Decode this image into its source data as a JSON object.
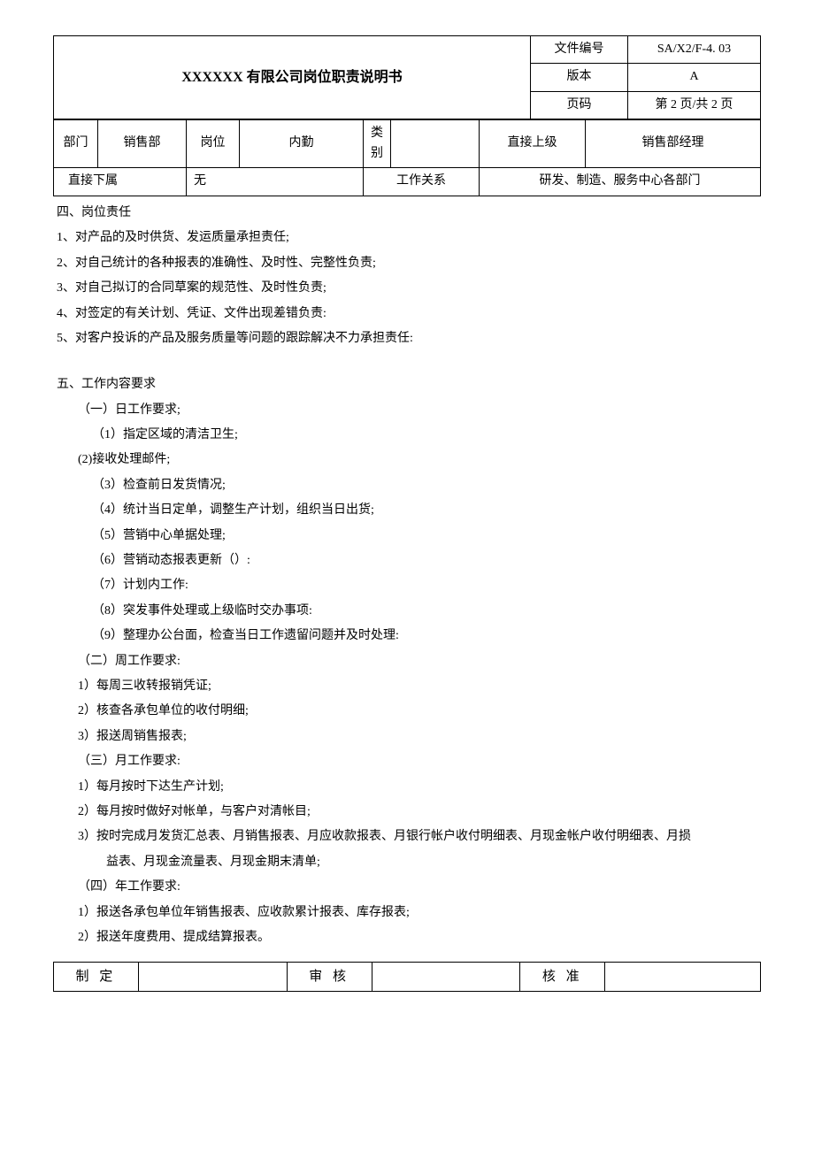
{
  "header": {
    "title": "XXXXXX 有限公司岗位职责说明书",
    "doc_no_label": "文件编号",
    "doc_no_value": "SA/X2/F-4. 03",
    "version_label": "版本",
    "version_value": "A",
    "page_label": "页码",
    "page_value": "第 2 页/共 2 页"
  },
  "info": {
    "dept_label": "部门",
    "dept_value": "销售部",
    "post_label": "岗位",
    "post_value": "内勤",
    "category_label": "类别",
    "category_value": "",
    "super_label": "直接上级",
    "super_value": "销售部经理",
    "sub_label": "直接下属",
    "sub_value": "无",
    "relation_label": "工作关系",
    "relation_value": "研发、制造、服务中心各部门"
  },
  "section4": {
    "title": "四、岗位责任",
    "i1": "1、对产品的及时供货、发运质量承担责任;",
    "i2": "2、对自己统计的各种报表的准确性、及时性、完整性负责;",
    "i3": "3、对自己拟订的合同草案的规范性、及时性负责;",
    "i4": "4、对签定的有关计划、凭证、文件出现差错负责:",
    "i5": "5、对客户投诉的产品及服务质量等问题的跟踪解决不力承担责任:"
  },
  "section5": {
    "title": "五、工作内容要求",
    "daily": {
      "title": "（一）日工作要求;",
      "i1": "（1）指定区域的清洁卫生;",
      "i2": "(2)接收处理邮件;",
      "i3": "（3）检查前日发货情况;",
      "i4": "（4）统计当日定单，调整生产计划，组织当日出货;",
      "i5": "（5）营销中心单据处理;",
      "i6": "（6）营销动态报表更新（）:",
      "i7": "（7）计划内工作:",
      "i8": "（8）突发事件处理或上级临时交办事项:",
      "i9": "（9）整理办公台面，检查当日工作遗留问题并及时处理:"
    },
    "weekly": {
      "title": "（二）周工作要求:",
      "i1": "1）每周三收转报销凭证;",
      "i2": "2）核查各承包单位的收付明细;",
      "i3": "3）报送周销售报表;"
    },
    "monthly": {
      "title": "（三）月工作要求:",
      "i1": "1）每月按时下达生产计划;",
      "i2": "2）每月按时做好对帐单，与客户对清帐目;",
      "i3_line1": "3）按时完成月发货汇总表、月销售报表、月应收款报表、月银行帐户收付明细表、月现金帐户收付明细表、月损",
      "i3_line2": "益表、月现金流量表、月现金期末清单;"
    },
    "yearly": {
      "title": "（四）年工作要求:",
      "i1": "1）报送各承包单位年销售报表、应收款累计报表、库存报表;",
      "i2": "2）报送年度费用、提成结算报表。"
    }
  },
  "sign": {
    "make": "制 定",
    "review": "审 核",
    "approve": "核 准"
  }
}
